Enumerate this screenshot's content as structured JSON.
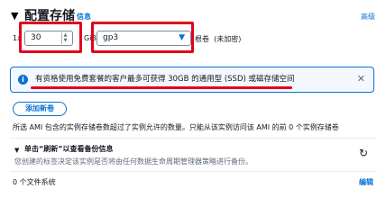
{
  "header": {
    "title": "配置存储",
    "info_label": "信息",
    "advanced_label": "高级"
  },
  "config": {
    "multiplier_label": "1x",
    "size_value": "30",
    "size_unit": "GiB",
    "volume_type": "gp3",
    "volume_label": "根卷",
    "encryption": "(未加密)"
  },
  "alert": {
    "text": "有资格使用免费套餐的客户最多可获得 30GB 的通用型 (SSD) 或磁存储空间"
  },
  "add_volume_label": "添加新卷",
  "ami_description": "所选 AMI 包含的实例存储卷数超过了实例允许的数量。只能从该实例访问该 AMI 的前 0 个实例存储卷",
  "backup": {
    "title": "单击“刷新”以查看备份信息",
    "description": "您创建的标签决定该实例是否将由任何数据生命周期管理器策略进行备份。"
  },
  "filesystems": {
    "count_label": "0 个文件系统",
    "edit_label": "编辑"
  },
  "colors": {
    "accent": "#0972d3",
    "highlight": "#e2001a",
    "alert_bg": "#f2f8fd"
  }
}
